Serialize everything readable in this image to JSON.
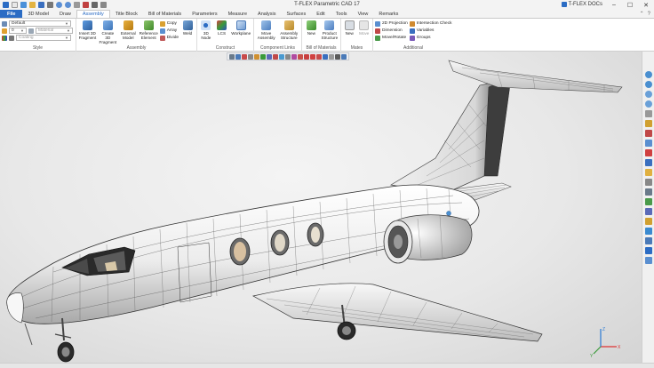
{
  "app": {
    "title": "T-FLEX Parametric CAD 17",
    "docs_label": "T-FLEX DOCs"
  },
  "tabs": [
    {
      "label": "File"
    },
    {
      "label": "3D Model"
    },
    {
      "label": "Draw"
    },
    {
      "label": "Assembly"
    },
    {
      "label": "Title Block"
    },
    {
      "label": "Bill of Materials"
    },
    {
      "label": "Parameters"
    },
    {
      "label": "Measure"
    },
    {
      "label": "Analysis"
    },
    {
      "label": "Surfaces"
    },
    {
      "label": "Edit"
    },
    {
      "label": "Tools"
    },
    {
      "label": "View"
    },
    {
      "label": "Remarks"
    }
  ],
  "style_group": {
    "label": "Style",
    "layer_value": "Default",
    "number_value": "0",
    "material_placeholder": "Material",
    "coating_placeholder": "Coating"
  },
  "assembly_group": {
    "label": "Assembly",
    "insert_label": "Insert 3D Fragment",
    "create_label": "Create 3D Fragment",
    "external_label": "External Model",
    "reference_label": "Reference Element",
    "copy_label": "Copy",
    "array_label": "Array",
    "divide_label": "Divide",
    "weld_label": "Weld"
  },
  "construct_group": {
    "label": "Construct",
    "node_label": "3D Node",
    "lcs_label": "LCS",
    "workplane_label": "Workplane"
  },
  "links_group": {
    "label": "Component Links",
    "move_label": "Move Assembly",
    "structure_label": "Assembly Structure"
  },
  "bom_group": {
    "label": "Bill of Materials",
    "new_label": "New",
    "product_label": "Product Structure"
  },
  "mates_group": {
    "label": "Mates",
    "new_label": "New",
    "move_label": "Move"
  },
  "additional_group": {
    "label": "Additional",
    "projection_label": "2D Projection",
    "dimension_label": "Dimension",
    "move_rotate_label": "Move/Rotate",
    "intersection_label": "Intersection Check",
    "variables_label": "Variables",
    "groups_label": "Groups"
  },
  "axes": {
    "x": "X",
    "y": "Y",
    "z": "Z"
  },
  "colors": {
    "accent": "#2b6cc4",
    "file_tab": "#2b6cc4",
    "model_light": "#f2f2f2",
    "model_dark": "#3a3a3a",
    "panel_lines": "#555555"
  }
}
